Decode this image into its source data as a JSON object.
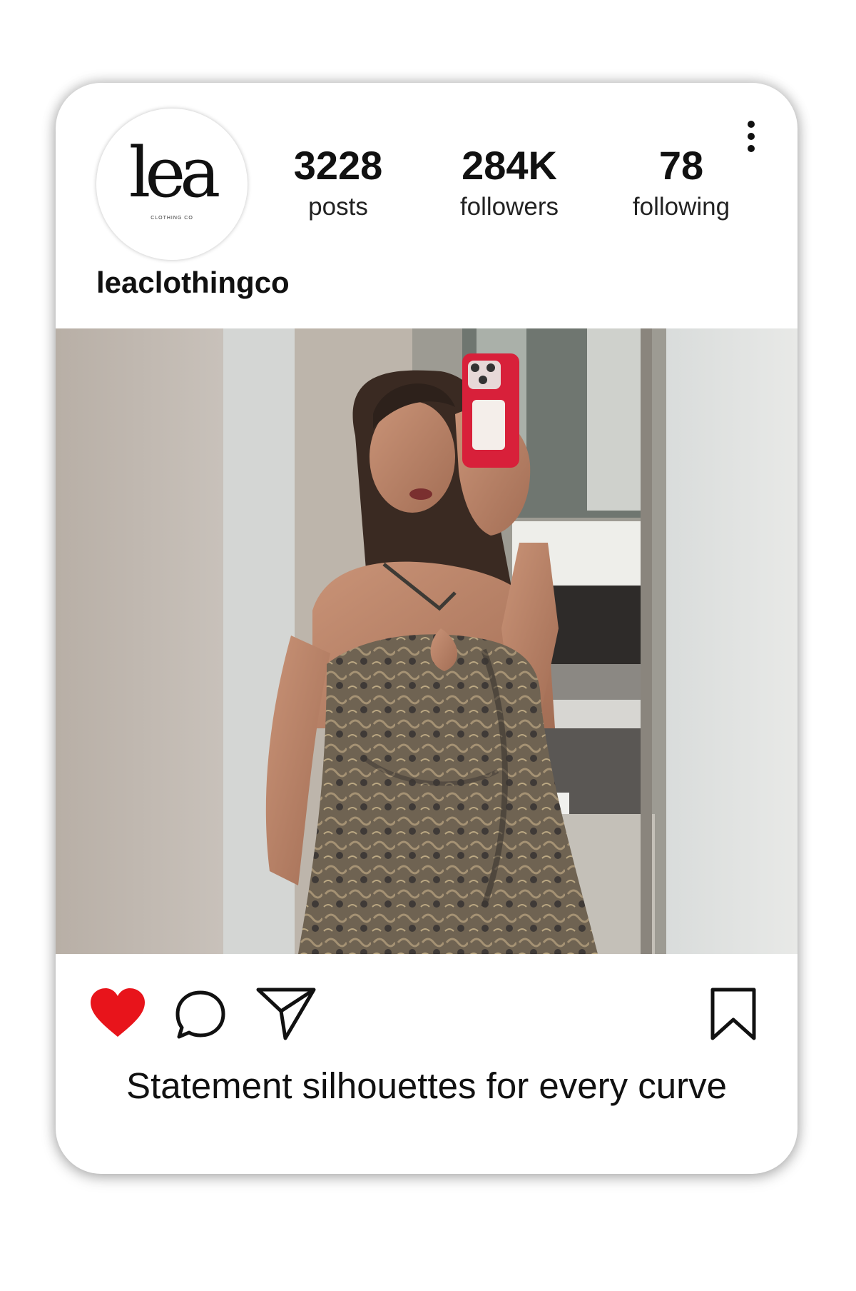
{
  "profile": {
    "logo_text": "lea",
    "logo_subtext": "CLOTHING CO",
    "username": "leaclothingco"
  },
  "stats": [
    {
      "value": "3228",
      "label": "posts"
    },
    {
      "value": "284K",
      "label": "followers"
    },
    {
      "value": "78",
      "label": "following"
    }
  ],
  "icons": {
    "more": "more-vertical-icon",
    "like": "heart-icon",
    "comment": "comment-bubble-icon",
    "share": "paper-plane-icon",
    "save": "bookmark-icon"
  },
  "colors": {
    "like_active": "#e8141b",
    "phone_case": "#d8203a"
  },
  "post": {
    "liked": true,
    "caption": "Statement silhouettes for every curve"
  }
}
